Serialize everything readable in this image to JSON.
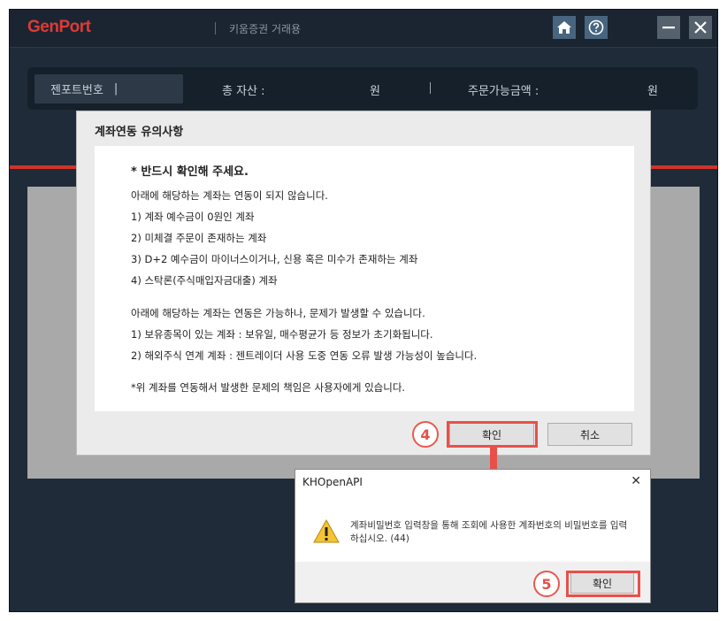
{
  "app": {
    "logo": "GenPort",
    "broker": "키움증권 거래용"
  },
  "info_bar": {
    "account_label": "젠포트번호",
    "account_sep": "|",
    "total_assets_label": "총 자산 :",
    "total_assets_unit": "원",
    "sep": "|",
    "orderable_label": "주문가능금액 :",
    "orderable_unit": "원"
  },
  "dialog": {
    "title": "계좌연동 유의사항",
    "heading": "* 반드시 확인해 주세요.",
    "lines": [
      "아래에 해당하는 계좌는 연동이 되지 않습니다.",
      "1) 계좌 예수금이 0원인 계좌",
      "2) 미체결 주문이 존재하는 계좌",
      "3) D+2 예수금이 마이너스이거나, 신용 혹은 미수가 존재하는 계좌",
      "4) 스탁론(주식매입자금대출) 계좌",
      "아래에 해당하는 계좌는 연동은 가능하나, 문제가 발생할 수 있습니다.",
      "1) 보유종목이 있는 계좌 : 보유일, 매수평균가 등 정보가 초기화됩니다.",
      "2) 해외주식 연계 계좌 : 젠트레이더 사용 도중 연동 오류 발생 가능성이 높습니다.",
      "*위 계좌를 연동해서 발생한 문제의 책임은 사용자에게 있습니다."
    ],
    "confirm_label": "확인",
    "cancel_label": "취소"
  },
  "annotations": {
    "step4": "4",
    "step5": "5"
  },
  "popup": {
    "title": "KHOpenAPI",
    "close": "✕",
    "message": "계좌비밀번호 입력창을 통해 조회에 사용한 계좌번호의 비밀번호를 입력하십시오. (44)",
    "confirm_label": "확인"
  },
  "colors": {
    "accent_red": "#e8504a",
    "frame_dark": "#1f2b38"
  },
  "icons": [
    "home-icon",
    "help-icon",
    "minimize-icon",
    "close-icon",
    "warning-icon",
    "arrow-down-icon"
  ]
}
